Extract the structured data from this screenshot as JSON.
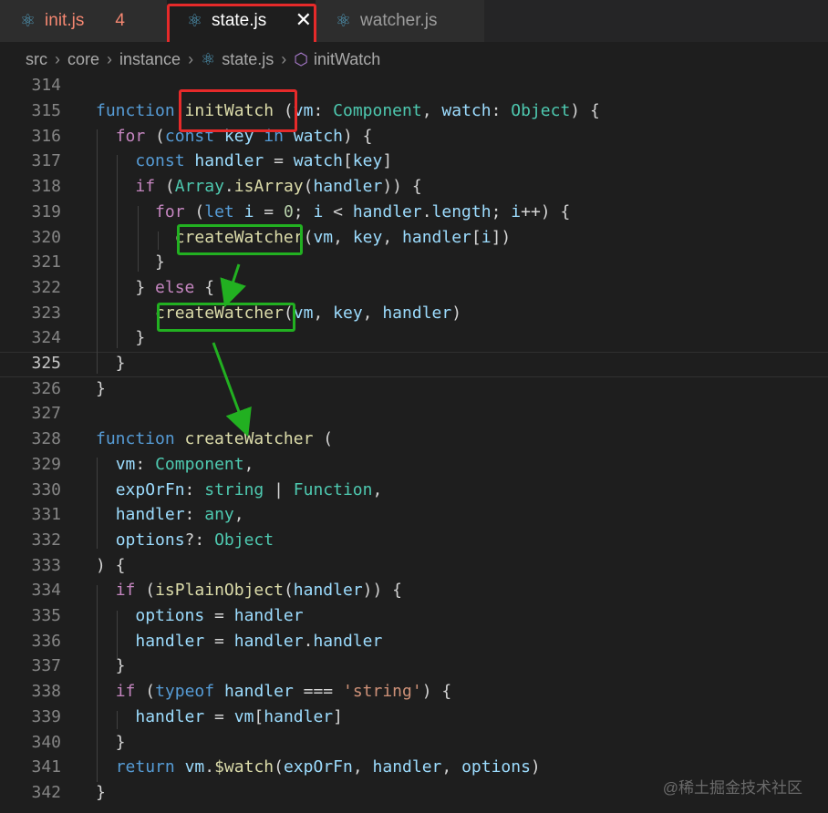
{
  "tabs": [
    {
      "label": "init.js",
      "badge": "4"
    },
    {
      "label": "state.js",
      "close": "✕"
    },
    {
      "label": "watcher.js"
    }
  ],
  "breadcrumb": [
    "src",
    "core",
    "instance",
    "state.js",
    "initWatch"
  ],
  "line_numbers": [
    "314",
    "315",
    "316",
    "317",
    "318",
    "319",
    "320",
    "321",
    "322",
    "323",
    "324",
    "325",
    "326",
    "327",
    "328",
    "329",
    "330",
    "331",
    "332",
    "333",
    "334",
    "335",
    "336",
    "337",
    "338",
    "339",
    "340",
    "341",
    "342"
  ],
  "active_line": "325",
  "code_lines": [
    "",
    "function initWatch (vm: Component, watch: Object) {",
    "  for (const key in watch) {",
    "    const handler = watch[key]",
    "    if (Array.isArray(handler)) {",
    "      for (let i = 0; i < handler.length; i++) {",
    "        createWatcher(vm, key, handler[i])",
    "      }",
    "    } else {",
    "      createWatcher(vm, key, handler)",
    "    }",
    "  }",
    "}",
    "",
    "function createWatcher (",
    "  vm: Component,",
    "  expOrFn: string | Function,",
    "  handler: any,",
    "  options?: Object",
    ") {",
    "  if (isPlainObject(handler)) {",
    "    options = handler",
    "    handler = handler.handler",
    "  }",
    "  if (typeof handler === 'string') {",
    "    handler = vm[handler]",
    "  }",
    "  return vm.$watch(expOrFn, handler, options)",
    "}"
  ],
  "watermark": "@稀土掘金技术社区",
  "colors": {
    "annotation_red": "#e62a2a",
    "annotation_green": "#22b021"
  }
}
